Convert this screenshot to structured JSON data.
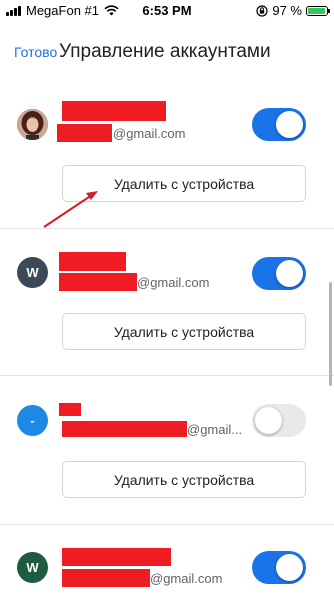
{
  "status_bar": {
    "carrier": "MegaFon #1",
    "time": "6:53 PM",
    "battery_percent": "97 %",
    "battery_level": 0.97,
    "icons": [
      "signal-icon",
      "wifi-icon",
      "orientation-lock-icon",
      "battery-icon"
    ]
  },
  "header": {
    "done_label": "Готово",
    "title": "Управление аккаунтами"
  },
  "colors": {
    "accent": "#1a73e8",
    "toggle_on": "#1a73e8",
    "toggle_off": "#e9e9eb",
    "redaction": "#ef1c24"
  },
  "accounts": [
    {
      "avatar_letter": "",
      "avatar_type": "photo",
      "email_suffix": "@gmail.com",
      "sync_enabled": true,
      "remove_label": "Удалить с устройства"
    },
    {
      "avatar_letter": "W",
      "avatar_color": "#3c4a57",
      "email_suffix": "@gmail.com",
      "sync_enabled": true,
      "remove_label": "Удалить с устройства"
    },
    {
      "avatar_letter": "-",
      "avatar_color": "#1e88e5",
      "email_suffix": "@gmail...",
      "sync_enabled": false,
      "remove_label": "Удалить с устройства"
    },
    {
      "avatar_letter": "W",
      "avatar_color": "#1e5b3f",
      "email_suffix": "@gmail.com",
      "sync_enabled": true
    }
  ]
}
